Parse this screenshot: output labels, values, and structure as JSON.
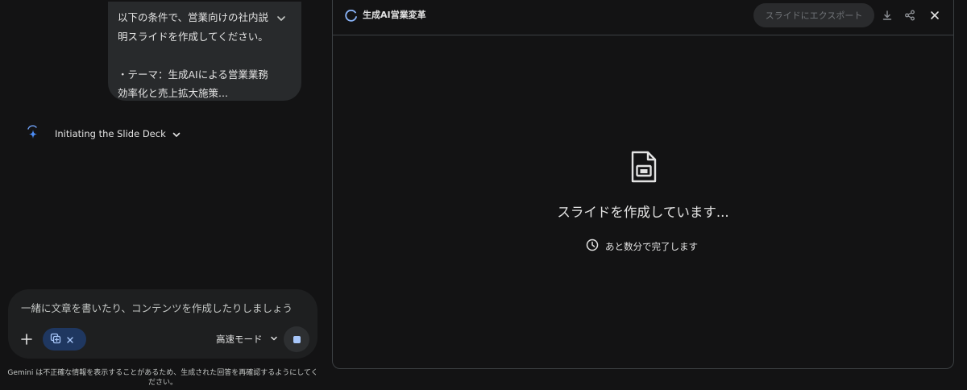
{
  "chat": {
    "user_message": "以下の条件で、営業向けの社内説\n明スライドを作成してください。\n\n・テーマ：生成AIによる営業業務\n効率化と売上拡大施策...",
    "thinking_label": "Initiating the Slide Deck",
    "composer": {
      "placeholder": "一緒に文章を書いたり、コンテンツを作成したりしましょう",
      "mode_label": "高速モード"
    },
    "disclaimer": "Gemini は不正確な情報を表示することがあるため、生成された回答を再確認するようにしてください。"
  },
  "canvas": {
    "title": "生成AI営業変革",
    "export_label": "スライドにエクスポート",
    "status_text": "スライドを作成しています...",
    "eta_text": "あと数分で完了します"
  },
  "colors": {
    "background": "#131314",
    "bubble": "#282a2c",
    "composer": "#1e1f20",
    "chip": "#1f3760",
    "accent": "#a8c7fa",
    "spark_blue": "#4c8df6",
    "border": "#3c4043"
  },
  "icons": {
    "bubble_chevron": "chevron-down-icon",
    "spark": "gemini-spark-icon",
    "plus": "plus-icon",
    "tool": "canvas-tool-icon",
    "close_chip": "close-icon",
    "download": "download-icon",
    "share": "share-icon",
    "close_canvas": "close-icon",
    "slide": "slide-document-icon",
    "clock": "clock-icon"
  }
}
